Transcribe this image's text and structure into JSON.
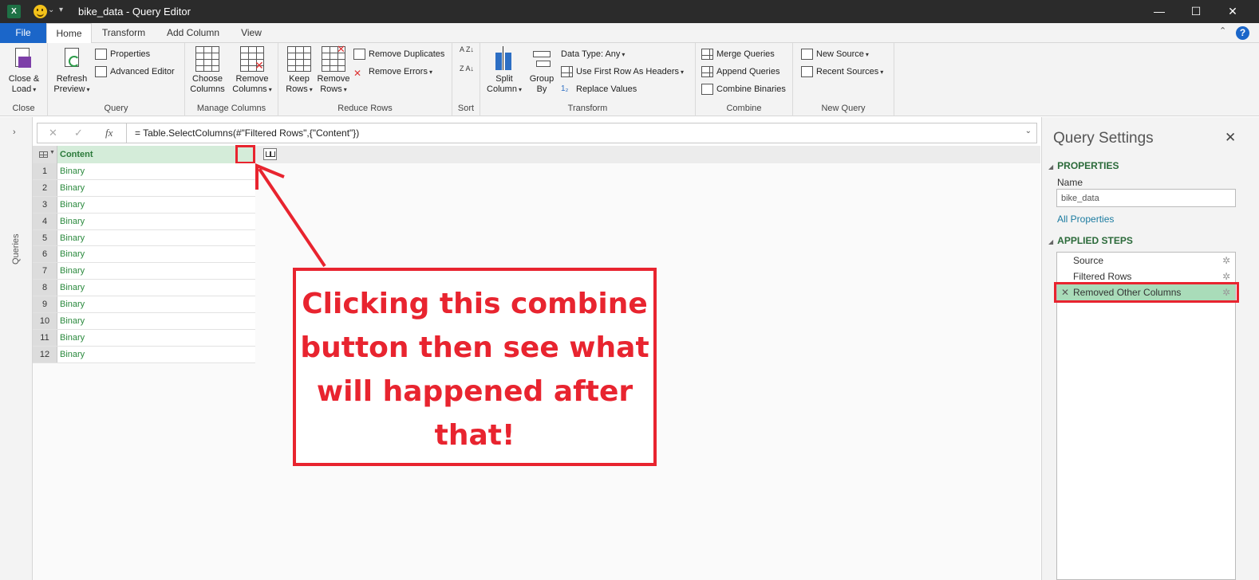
{
  "window": {
    "title": "bike_data - Query Editor",
    "app_icon_text": "X",
    "controls": {
      "minimize": "—",
      "maximize": "☐",
      "close": "✕"
    }
  },
  "tabs": [
    {
      "label": "File"
    },
    {
      "label": "Home",
      "active": true
    },
    {
      "label": "Transform"
    },
    {
      "label": "Add Column"
    },
    {
      "label": "View"
    }
  ],
  "help_icon": "?",
  "ribbon": {
    "close": {
      "group": "Close",
      "close_load": "Close &",
      "close_load2": "Load"
    },
    "query": {
      "group": "Query",
      "refresh": "Refresh",
      "refresh2": "Preview",
      "properties": "Properties",
      "advanced_editor": "Advanced Editor"
    },
    "manage_columns": {
      "group": "Manage Columns",
      "choose": "Choose",
      "choose2": "Columns",
      "remove": "Remove",
      "remove2": "Columns"
    },
    "reduce_rows": {
      "group": "Reduce Rows",
      "keep": "Keep",
      "keep2": "Rows",
      "remove": "Remove",
      "remove2": "Rows",
      "remove_duplicates": "Remove Duplicates",
      "remove_errors": "Remove Errors"
    },
    "sort": {
      "group": "Sort",
      "asc": "A Z",
      "desc": "Z A"
    },
    "transform": {
      "group": "Transform",
      "split": "Split",
      "split2": "Column",
      "group_by": "Group",
      "group_by2": "By",
      "data_type": "Data Type: Any",
      "first_row_headers": "Use First Row As Headers",
      "replace_values": "Replace Values"
    },
    "combine": {
      "group": "Combine",
      "merge": "Merge Queries",
      "append": "Append Queries",
      "combine_binaries": "Combine Binaries"
    },
    "new_query": {
      "group": "New Query",
      "new_source": "New Source",
      "recent_sources": "Recent Sources"
    }
  },
  "queries_pane": {
    "label": "Queries",
    "chevron": "›"
  },
  "formula_bar": {
    "cancel": "✕",
    "commit": "✓",
    "fx": "fx",
    "formula": "= Table.SelectColumns(#\"Filtered Rows\",{\"Content\"})"
  },
  "table": {
    "column": "Content",
    "rows": [
      {
        "n": "1",
        "v": "Binary"
      },
      {
        "n": "2",
        "v": "Binary"
      },
      {
        "n": "3",
        "v": "Binary"
      },
      {
        "n": "4",
        "v": "Binary"
      },
      {
        "n": "5",
        "v": "Binary"
      },
      {
        "n": "6",
        "v": "Binary"
      },
      {
        "n": "7",
        "v": "Binary"
      },
      {
        "n": "8",
        "v": "Binary"
      },
      {
        "n": "9",
        "v": "Binary"
      },
      {
        "n": "10",
        "v": "Binary"
      },
      {
        "n": "11",
        "v": "Binary"
      },
      {
        "n": "12",
        "v": "Binary"
      }
    ]
  },
  "annotation": {
    "lines": [
      "Clicking this combine",
      "button then see what",
      "will happened after",
      "that!"
    ],
    "color": "#e8242f"
  },
  "query_settings": {
    "title": "Query Settings",
    "properties_header": "PROPERTIES",
    "name_label": "Name",
    "name_value": "bike_data",
    "all_properties": "All Properties",
    "applied_steps_header": "APPLIED STEPS",
    "steps": [
      {
        "label": "Source"
      },
      {
        "label": "Filtered Rows"
      },
      {
        "label": "Removed Other Columns",
        "selected": true
      }
    ]
  }
}
